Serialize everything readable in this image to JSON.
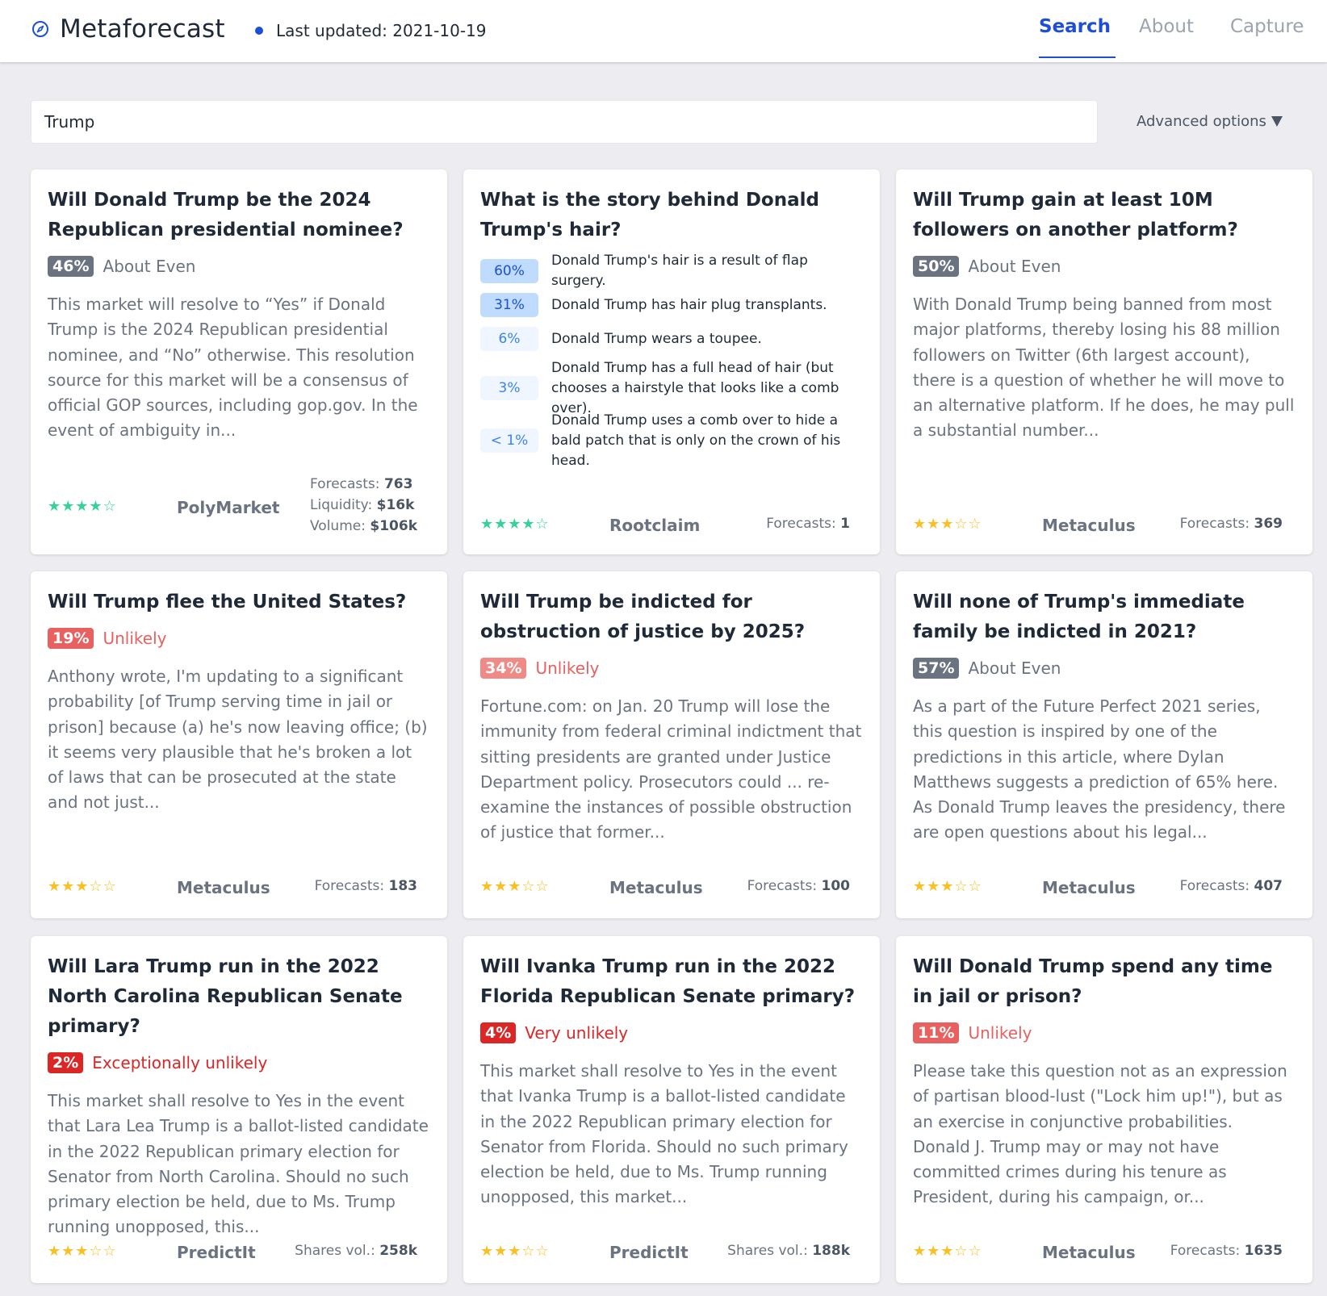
{
  "header": {
    "brand": "Metaforecast",
    "last_updated": "Last updated: 2021-10-19",
    "tabs": [
      "Search",
      "About",
      "Capture"
    ],
    "active_tab": "Search"
  },
  "search": {
    "value": "Trump",
    "advanced_label": "Advanced options"
  },
  "colors": {
    "accent": "#1d4ed8",
    "about_even": "#6b7280",
    "unlikely": "#e8605f",
    "unlikely_light": "#ef8a87",
    "very_unlikely": "#dc2626",
    "star_green": "#34d399",
    "star_yellow": "#fbbf24"
  },
  "cards": [
    {
      "title": "Will Donald Trump be the 2024 Republican presidential nominee?",
      "probability": "46%",
      "label": "About Even",
      "description": "This market will resolve to “Yes” if Donald Trump is the 2024 Republican presidential nominee, and “No” otherwise. This resolution source for this market will be a consensus of official GOP sources, including gop.gov. In the event of ambiguity in...",
      "stars": "★★★★☆",
      "star_color": "green",
      "platform": "PolyMarket",
      "stats": [
        {
          "label": "Forecasts:",
          "value": "763"
        },
        {
          "label": "Liquidity:",
          "value": "$16k"
        },
        {
          "label": "Volume:",
          "value": "$106k"
        }
      ]
    },
    {
      "title": "What is the story behind Donald Trump's hair?",
      "options": [
        {
          "probability": "60%",
          "text": "Donald Trump's hair is a result of flap surgery."
        },
        {
          "probability": "31%",
          "text": "Donald Trump has hair plug transplants."
        },
        {
          "probability": "6%",
          "text": "Donald Trump wears a toupee."
        },
        {
          "probability": "3%",
          "text": "Donald Trump has a full head of hair (but chooses a hairstyle that looks like a comb over)."
        },
        {
          "probability": "< 1%",
          "text": "Donald Trump uses a comb over to hide a bald patch that is only on the crown of his head."
        }
      ],
      "stars": "★★★★☆",
      "star_color": "green",
      "platform": "Rootclaim",
      "stats": [
        {
          "label": "Forecasts:",
          "value": "1"
        }
      ]
    },
    {
      "title": "Will Trump gain at least 10M followers on another platform?",
      "probability": "50%",
      "label": "About Even",
      "description": "With Donald Trump being banned from most major platforms, thereby losing his 88 million followers on Twitter (6th largest account), there is a question of whether he will move to an alternative platform. If he does, he may pull a substantial number...",
      "stars": "★★★☆☆",
      "star_color": "yellow",
      "platform": "Metaculus",
      "stats": [
        {
          "label": "Forecasts:",
          "value": "369"
        }
      ]
    },
    {
      "title": "Will Trump flee the United States?",
      "probability": "19%",
      "label": "Unlikely",
      "description": "Anthony wrote, I'm updating to a significant probability [of Trump serving time in jail or prison] because (a) he's now leaving office; (b) it seems very plausible that he's broken a lot of laws that can be prosecuted at the state and not just...",
      "stars": "★★★☆☆",
      "star_color": "yellow",
      "platform": "Metaculus",
      "stats": [
        {
          "label": "Forecasts:",
          "value": "183"
        }
      ]
    },
    {
      "title": "Will Trump be indicted for obstruction of justice by 2025?",
      "probability": "34%",
      "label": "Unlikely",
      "description": "Fortune.com: on Jan. 20 Trump will lose the immunity from federal criminal indictment that sitting presidents are granted under Justice Department policy. Prosecutors could ... re-examine the instances of possible obstruction of justice that former...",
      "stars": "★★★☆☆",
      "star_color": "yellow",
      "platform": "Metaculus",
      "stats": [
        {
          "label": "Forecasts:",
          "value": "100"
        }
      ]
    },
    {
      "title": "Will none of Trump's immediate family be indicted in 2021?",
      "probability": "57%",
      "label": "About Even",
      "description": "As a part of the Future Perfect 2021 series, this question is inspired by one of the predictions in this article, where Dylan Matthews suggests a prediction of 65% here. As Donald Trump leaves the presidency, there are open questions about his legal...",
      "stars": "★★★☆☆",
      "star_color": "yellow",
      "platform": "Metaculus",
      "stats": [
        {
          "label": "Forecasts:",
          "value": "407"
        }
      ]
    },
    {
      "title": "Will Lara Trump run in the 2022 North Carolina Republican Senate primary?",
      "probability": "2%",
      "label": "Exceptionally unlikely",
      "description": "This market shall resolve to Yes in the event that Lara Lea Trump is a ballot-listed candidate in the 2022 Republican primary election for Senator from North Carolina. Should no such primary election be held, due to Ms. Trump running unopposed, this...",
      "stars": "★★★☆☆",
      "star_color": "yellow",
      "platform": "PredictIt",
      "stats": [
        {
          "label": "Shares vol.:",
          "value": "258k"
        }
      ]
    },
    {
      "title": "Will Ivanka Trump run in the 2022 Florida Republican Senate primary?",
      "probability": "4%",
      "label": "Very unlikely",
      "description": "This market shall resolve to Yes in the event that Ivanka Trump is a ballot-listed candidate in the 2022 Republican primary election for Senator from Florida. Should no such primary election be held, due to Ms. Trump running unopposed, this market...",
      "stars": "★★★☆☆",
      "star_color": "yellow",
      "platform": "PredictIt",
      "stats": [
        {
          "label": "Shares vol.:",
          "value": "188k"
        }
      ]
    },
    {
      "title": "Will Donald Trump spend any time in jail or prison?",
      "probability": "11%",
      "label": "Unlikely",
      "description": "Please take this question not as an expression of partisan blood-lust (\"Lock him up!\"), but as an exercise in conjunctive probabilities. Donald J. Trump may or may not have committed crimes during his tenure as President, during his campaign, or...",
      "stars": "★★★☆☆",
      "star_color": "yellow",
      "platform": "Metaculus",
      "stats": [
        {
          "label": "Forecasts:",
          "value": "1635"
        }
      ]
    }
  ]
}
